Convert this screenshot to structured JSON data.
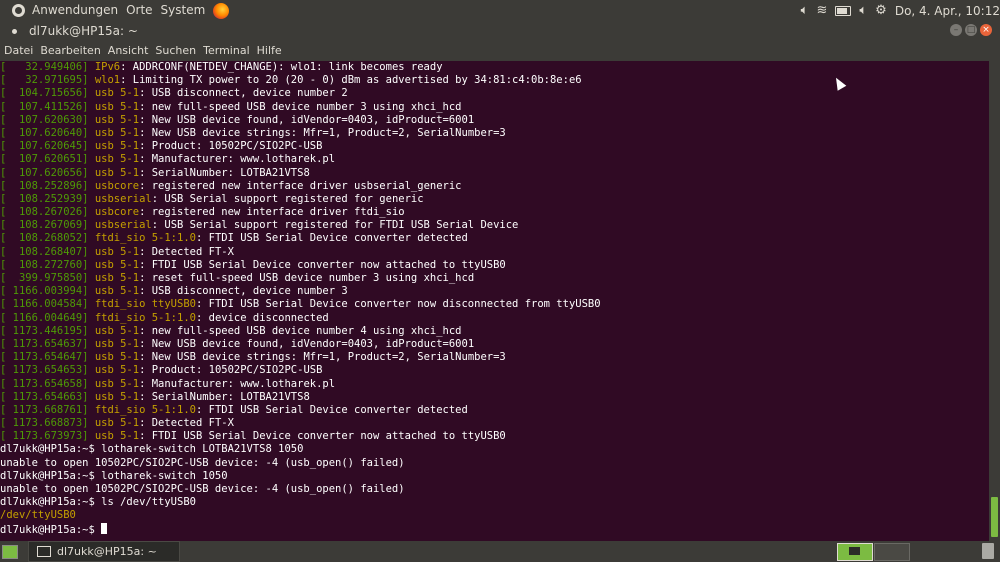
{
  "top_panel": {
    "menus": [
      "Anwendungen",
      "Orte",
      "System"
    ],
    "clock": "Do, 4. Apr., 10:12"
  },
  "window": {
    "title": "dl7ukk@HP15a: ~"
  },
  "menubar": [
    "Datei",
    "Bearbeiten",
    "Ansicht",
    "Suchen",
    "Terminal",
    "Hilfe"
  ],
  "terminal": {
    "lines": [
      {
        "ts": "[   32.949406]",
        "mod": "IPv6",
        "rest": ": ADDRCONF(NETDEV_CHANGE): wlo1: link becomes ready"
      },
      {
        "ts": "[   32.971695]",
        "mod": "wlo1",
        "rest": ": Limiting TX power to 20 (20 - 0) dBm as advertised by 34:81:c4:0b:8e:e6"
      },
      {
        "ts": "[  104.715656]",
        "mod": "usb 5-1",
        "rest": ": USB disconnect, device number 2"
      },
      {
        "ts": "[  107.411526]",
        "mod": "usb 5-1",
        "rest": ": new full-speed USB device number 3 using xhci_hcd"
      },
      {
        "ts": "[  107.620630]",
        "mod": "usb 5-1",
        "rest": ": New USB device found, idVendor=0403, idProduct=6001"
      },
      {
        "ts": "[  107.620640]",
        "mod": "usb 5-1",
        "rest": ": New USB device strings: Mfr=1, Product=2, SerialNumber=3"
      },
      {
        "ts": "[  107.620645]",
        "mod": "usb 5-1",
        "rest": ": Product: 10502PC/SIO2PC-USB"
      },
      {
        "ts": "[  107.620651]",
        "mod": "usb 5-1",
        "rest": ": Manufacturer: www.lotharek.pl"
      },
      {
        "ts": "[  107.620656]",
        "mod": "usb 5-1",
        "rest": ": SerialNumber: LOTBA21VTS8"
      },
      {
        "ts": "[  108.252896]",
        "mod": "usbcore",
        "rest": ": registered new interface driver usbserial_generic"
      },
      {
        "ts": "[  108.252939]",
        "mod": "usbserial",
        "rest": ": USB Serial support registered for generic"
      },
      {
        "ts": "[  108.267026]",
        "mod": "usbcore",
        "rest": ": registered new interface driver ftdi_sio"
      },
      {
        "ts": "[  108.267069]",
        "mod": "usbserial",
        "rest": ": USB Serial support registered for FTDI USB Serial Device"
      },
      {
        "ts": "[  108.268052]",
        "mod": "ftdi_sio 5-1:1.0",
        "rest": ": FTDI USB Serial Device converter detected"
      },
      {
        "ts": "[  108.268407]",
        "mod": "usb 5-1",
        "rest": ": Detected FT-X"
      },
      {
        "ts": "[  108.272760]",
        "mod": "usb 5-1",
        "rest": ": FTDI USB Serial Device converter now attached to ttyUSB0"
      },
      {
        "ts": "[  399.975850]",
        "mod": "usb 5-1",
        "rest": ": reset full-speed USB device number 3 using xhci_hcd"
      },
      {
        "ts": "[ 1166.003994]",
        "mod": "usb 5-1",
        "rest": ": USB disconnect, device number 3"
      },
      {
        "ts": "[ 1166.004584]",
        "mod": "ftdi_sio ttyUSB0",
        "rest": ": FTDI USB Serial Device converter now disconnected from ttyUSB0"
      },
      {
        "ts": "[ 1166.004649]",
        "mod": "ftdi_sio 5-1:1.0",
        "rest": ": device disconnected"
      },
      {
        "ts": "[ 1173.446195]",
        "mod": "usb 5-1",
        "rest": ": new full-speed USB device number 4 using xhci_hcd"
      },
      {
        "ts": "[ 1173.654637]",
        "mod": "usb 5-1",
        "rest": ": New USB device found, idVendor=0403, idProduct=6001"
      },
      {
        "ts": "[ 1173.654647]",
        "mod": "usb 5-1",
        "rest": ": New USB device strings: Mfr=1, Product=2, SerialNumber=3"
      },
      {
        "ts": "[ 1173.654653]",
        "mod": "usb 5-1",
        "rest": ": Product: 10502PC/SIO2PC-USB"
      },
      {
        "ts": "[ 1173.654658]",
        "mod": "usb 5-1",
        "rest": ": Manufacturer: www.lotharek.pl"
      },
      {
        "ts": "[ 1173.654663]",
        "mod": "usb 5-1",
        "rest": ": SerialNumber: LOTBA21VTS8"
      },
      {
        "ts": "[ 1173.668761]",
        "mod": "ftdi_sio 5-1:1.0",
        "rest": ": FTDI USB Serial Device converter detected"
      },
      {
        "ts": "[ 1173.668873]",
        "mod": "usb 5-1",
        "rest": ": Detected FT-X"
      },
      {
        "ts": "[ 1173.673973]",
        "mod": "usb 5-1",
        "rest": ": FTDI USB Serial Device converter now attached to ttyUSB0"
      }
    ],
    "plain_lines": [
      "dl7ukk@HP15a:~$ lotharek-switch LOTBA21VTS8 1050",
      "unable to open 10502PC/SIO2PC-USB device: -4 (usb_open() failed)",
      "dl7ukk@HP15a:~$ lotharek-switch 1050",
      "unable to open 10502PC/SIO2PC-USB device: -4 (usb_open() failed)",
      "dl7ukk@HP15a:~$ ls /dev/ttyUSB0",
      "/dev/ttyUSB0"
    ],
    "prompt": "dl7ukk@HP15a:~$ "
  },
  "taskbar": {
    "task_label": "dl7ukk@HP15a: ~"
  },
  "colors": {
    "terminal_bg": "#300a24",
    "timestamp": "#4e9a06",
    "module": "#c4a000",
    "panel": "#3c3b37",
    "accent": "#7cbb42"
  }
}
